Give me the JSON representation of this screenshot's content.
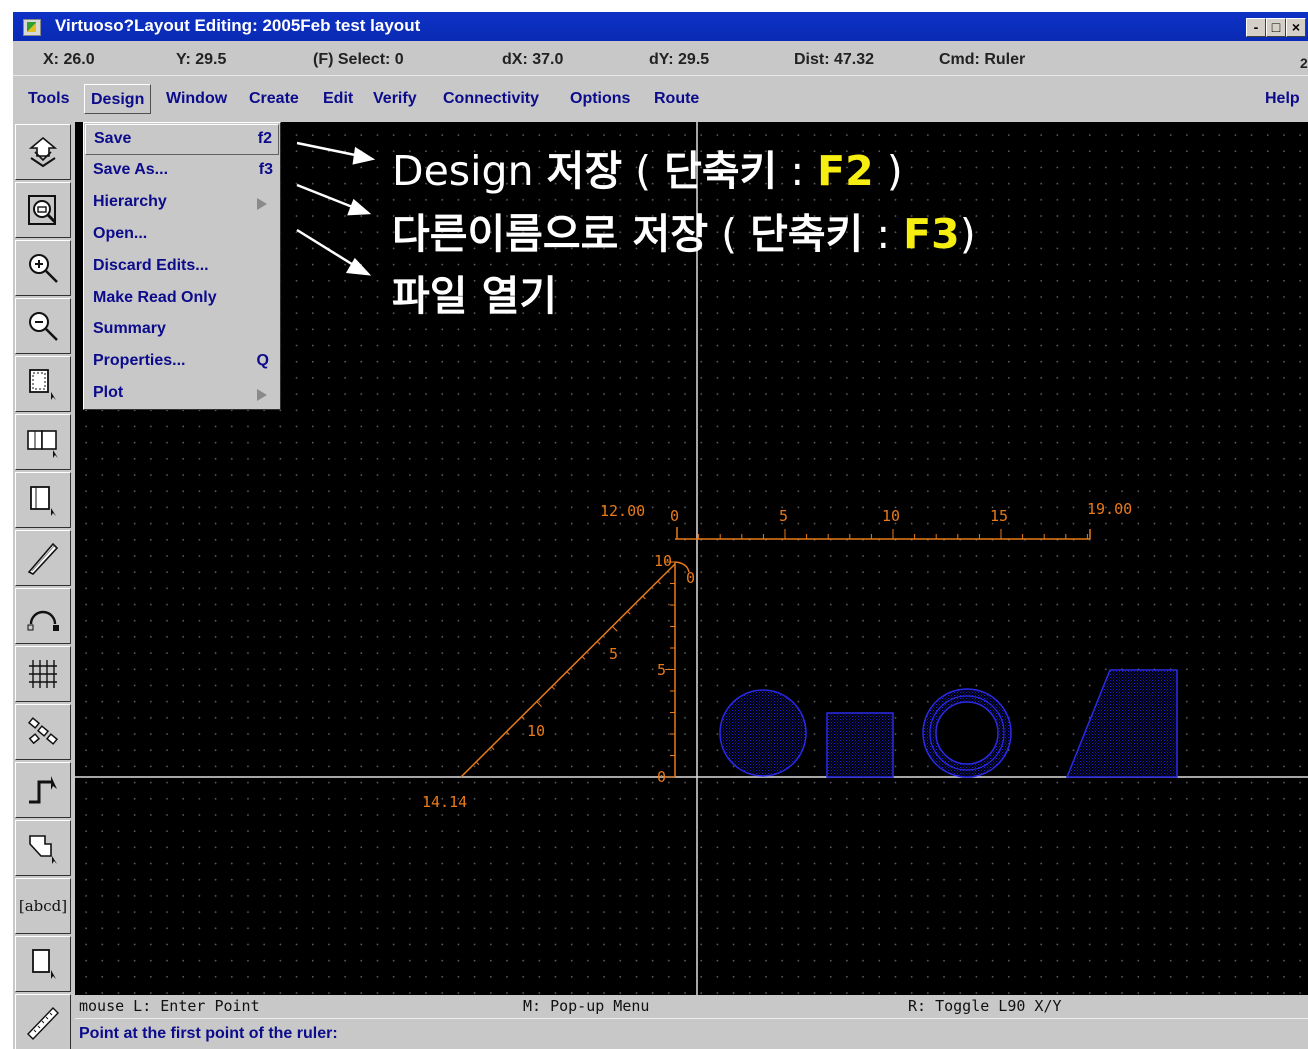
{
  "window": {
    "title": "Virtuoso?Layout Editing: 2005Feb test layout",
    "controls": [
      "-",
      "□",
      "×"
    ]
  },
  "coords": {
    "x": "X: 26.0",
    "y": "Y: 29.5",
    "select": "(F) Select: 0",
    "dx": "dX: 37.0",
    "dy": "dY: 29.5",
    "dist": "Dist: 47.32",
    "cmd": "Cmd: Ruler",
    "edge": "2"
  },
  "menubar": {
    "items": [
      "Tools",
      "Design",
      "Window",
      "Create",
      "Edit",
      "Verify",
      "Connectivity",
      "Options",
      "Route"
    ],
    "help": "Help",
    "active": "Design"
  },
  "design_menu": {
    "items": [
      {
        "label": "Save",
        "shortcut": "f2",
        "submenu": false
      },
      {
        "label": "Save As...",
        "shortcut": "f3",
        "submenu": false
      },
      {
        "label": "Hierarchy",
        "shortcut": "",
        "submenu": true
      },
      {
        "label": "Open...",
        "shortcut": "",
        "submenu": false
      },
      {
        "label": "Discard Edits...",
        "shortcut": "",
        "submenu": false
      },
      {
        "label": "Make Read Only",
        "shortcut": "",
        "submenu": false
      },
      {
        "label": "Summary",
        "shortcut": "",
        "submenu": false
      },
      {
        "label": "Properties...",
        "shortcut": "Q",
        "submenu": false
      },
      {
        "label": "Plot",
        "shortcut": "",
        "submenu": true
      }
    ]
  },
  "annotations": {
    "line1_a": "Design ",
    "line1_b": "저장",
    "line1_c": " ( ",
    "line1_d": "단축키",
    "line1_e": " : ",
    "line1_key": "F2",
    "line1_f": " )",
    "line2_a": "다른이름으로 저장",
    "line2_b": " ( ",
    "line2_c": "단축키",
    "line2_d": " : ",
    "line2_key": "F3",
    "line2_e": ")",
    "line3": "파일 열기"
  },
  "toolbar": {
    "icons": [
      "save-icon",
      "fit-view-icon",
      "zoom-in-icon",
      "zoom-out-icon",
      "rectangle-icon",
      "instance-icon",
      "selection-box-icon",
      "path-icon",
      "arc-icon",
      "contact-grid-icon",
      "move-icon",
      "stretch-icon",
      "polygon-icon",
      "label-icon",
      "copy-icon",
      "ruler-icon"
    ],
    "label_tool_text": "[abcd]"
  },
  "rulers": {
    "horizontal": {
      "start_label": "12.00",
      "end_label": "19.00",
      "ticks": [
        "0",
        "5",
        "10",
        "15"
      ]
    },
    "vertical": {
      "top_label": "10",
      "ticks": [
        "5",
        "0"
      ],
      "corner_label": "0"
    },
    "diagonal": {
      "end_label": "14.14",
      "ticks": [
        "5",
        "10"
      ]
    }
  },
  "status": {
    "mouse_l": "mouse L: Enter Point",
    "mouse_m": "M: Pop-up Menu",
    "mouse_r": "R: Toggle L90 X/Y"
  },
  "prompt": "Point at the first point of the ruler:",
  "colors": {
    "title_bar": "#0e32c6",
    "ruler": "#e87a1a",
    "shapes": "#1b1bd8",
    "menu_text": "#0b0b8c",
    "highlight_key": "#f6ee10"
  }
}
